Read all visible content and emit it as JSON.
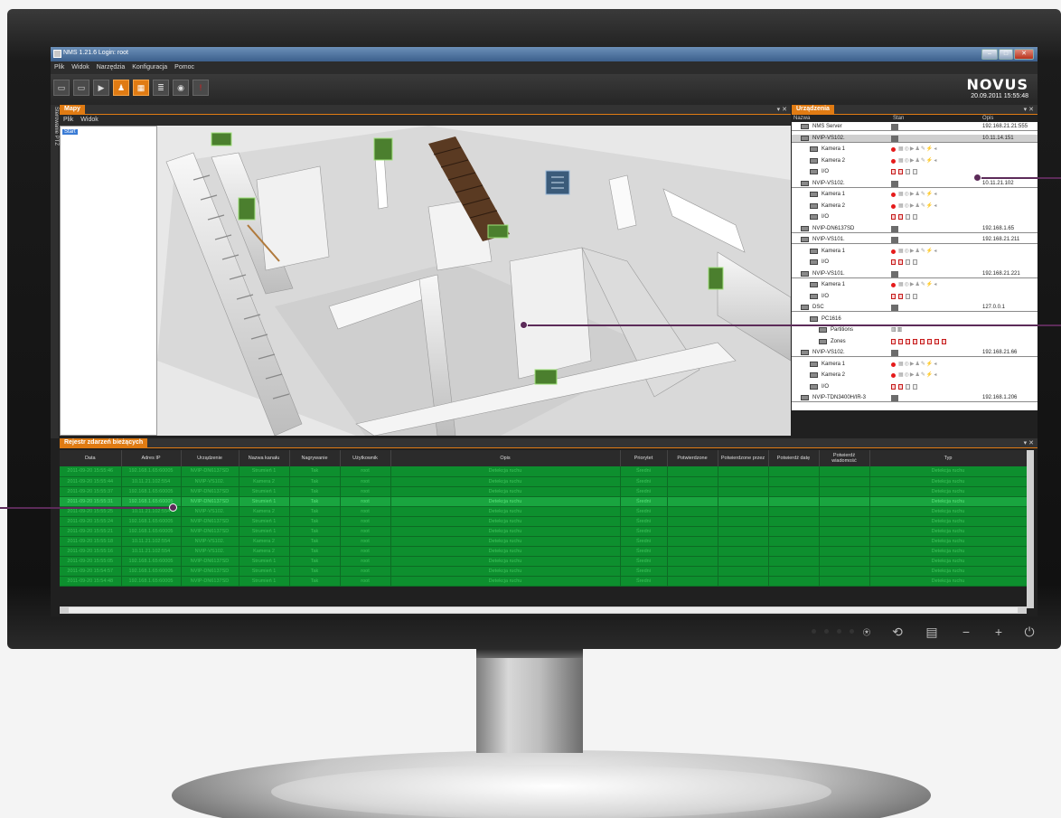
{
  "window": {
    "title": "NMS  1.21.6 Login: root"
  },
  "menu": [
    "Plik",
    "Widok",
    "Narzędzia",
    "Konfiguracja",
    "Pomoc"
  ],
  "header": {
    "logo": "NOVUS",
    "datetime": "20.09.2011 15:55:48"
  },
  "side_tab": "Sterowanie PTZ",
  "maps_panel": {
    "tab": "Mapy",
    "menu": [
      "Plik",
      "Widok"
    ],
    "tree_selected": "Start"
  },
  "devices_panel": {
    "tab": "Urządzenia",
    "columns": [
      "Nazwa",
      "Stan",
      "Opis"
    ],
    "rows": [
      {
        "name": "NMS Server",
        "level": 0,
        "ip": "192.168.21.21:555"
      },
      {
        "name": "NVIP-VS102.",
        "level": 0,
        "ip": "10.11.14.151"
      },
      {
        "name": "Kamera 1",
        "level": 1,
        "ip": ""
      },
      {
        "name": "Kamera 2",
        "level": 1,
        "ip": ""
      },
      {
        "name": "I/O",
        "level": 1,
        "ip": ""
      },
      {
        "name": "NVIP-VS102.",
        "level": 0,
        "ip": "10.11.21.102"
      },
      {
        "name": "Kamera 1",
        "level": 1,
        "ip": ""
      },
      {
        "name": "Kamera 2",
        "level": 1,
        "ip": ""
      },
      {
        "name": "I/O",
        "level": 1,
        "ip": ""
      },
      {
        "name": "NVIP-DN6137SD",
        "level": 0,
        "ip": "192.168.1.65"
      },
      {
        "name": "NVIP-VS101.",
        "level": 0,
        "ip": "192.168.21.211"
      },
      {
        "name": "Kamera 1",
        "level": 1,
        "ip": ""
      },
      {
        "name": "I/O",
        "level": 1,
        "ip": ""
      },
      {
        "name": "NVIP-VS101.",
        "level": 0,
        "ip": "192.168.21.221"
      },
      {
        "name": "Kamera 1",
        "level": 1,
        "ip": ""
      },
      {
        "name": "I/O",
        "level": 1,
        "ip": ""
      },
      {
        "name": "DSC",
        "level": 0,
        "ip": "127.0.0.1"
      },
      {
        "name": "PC1616",
        "level": 1,
        "ip": ""
      },
      {
        "name": "Partitions",
        "level": 2,
        "ip": ""
      },
      {
        "name": "Zones",
        "level": 2,
        "ip": ""
      },
      {
        "name": "NVIP-VS102.",
        "level": 0,
        "ip": "192.168.21.66"
      },
      {
        "name": "Kamera 1",
        "level": 1,
        "ip": ""
      },
      {
        "name": "Kamera 2",
        "level": 1,
        "ip": ""
      },
      {
        "name": "I/O",
        "level": 1,
        "ip": ""
      },
      {
        "name": "NVIP-TDN3400H/IR-3",
        "level": 0,
        "ip": "192.168.1.206"
      }
    ]
  },
  "event_log": {
    "tab": "Rejestr zdarzeń bieżących",
    "columns": [
      "Data",
      "Adres IP",
      "Urządzenie",
      "Nazwa kanału",
      "Nagrywanie",
      "Użytkownik",
      "Opis",
      "Priorytet",
      "Potwierdzone",
      "Potwierdzone przez",
      "Potwierdź datę",
      "Potwierdź wiadomość",
      "Typ"
    ],
    "rows": [
      [
        "2011-09-20 15:55:46",
        "192.168.1.65:60005",
        "NVIP-DN6137SD",
        "Strumień 1",
        "Tak",
        "root",
        "Detekcja ruchu",
        "Średni",
        "",
        "",
        "",
        "",
        "Detekcja ruchu"
      ],
      [
        "2011-09-20 15:55:44",
        "10.11.21.102:554",
        "NVIP-VS102.",
        "Kamera 2",
        "Tak",
        "root",
        "Detekcja ruchu",
        "Średni",
        "",
        "",
        "",
        "",
        "Detekcja ruchu"
      ],
      [
        "2011-09-20 15:55:37",
        "192.168.1.65:60005",
        "NVIP-DN6137SD",
        "Strumień 1",
        "Tak",
        "root",
        "Detekcja ruchu",
        "Średni",
        "",
        "",
        "",
        "",
        "Detekcja ruchu"
      ],
      [
        "2011-09-20 15:55:31",
        "192.168.1.65:60005",
        "NVIP-DN6137SD",
        "Strumień 1",
        "Tak",
        "root",
        "Detekcja ruchu",
        "Średni",
        "",
        "",
        "",
        "",
        "Detekcja ruchu"
      ],
      [
        "2011-09-20 15:55:25",
        "10.11.21.102:554",
        "NVIP-VS102.",
        "Kamera 2",
        "Tak",
        "root",
        "Detekcja ruchu",
        "Średni",
        "",
        "",
        "",
        "",
        "Detekcja ruchu"
      ],
      [
        "2011-09-20 15:55:24",
        "192.168.1.65:60005",
        "NVIP-DN6137SD",
        "Strumień 1",
        "Tak",
        "root",
        "Detekcja ruchu",
        "Średni",
        "",
        "",
        "",
        "",
        "Detekcja ruchu"
      ],
      [
        "2011-09-20 15:55:21",
        "192.168.1.65:60005",
        "NVIP-DN6137SD",
        "Strumień 1",
        "Tak",
        "root",
        "Detekcja ruchu",
        "Średni",
        "",
        "",
        "",
        "",
        "Detekcja ruchu"
      ],
      [
        "2011-09-20 15:55:18",
        "10.11.21.102:554",
        "NVIP-VS102.",
        "Kamera 2",
        "Tak",
        "root",
        "Detekcja ruchu",
        "Średni",
        "",
        "",
        "",
        "",
        "Detekcja ruchu"
      ],
      [
        "2011-09-20 15:55:16",
        "10.11.21.102:554",
        "NVIP-VS102.",
        "Kamera 2",
        "Tak",
        "root",
        "Detekcja ruchu",
        "Średni",
        "",
        "",
        "",
        "",
        "Detekcja ruchu"
      ],
      [
        "2011-09-20 15:55:05",
        "192.168.1.65:60005",
        "NVIP-DN6137SD",
        "Strumień 1",
        "Tak",
        "root",
        "Detekcja ruchu",
        "Średni",
        "",
        "",
        "",
        "",
        "Detekcja ruchu"
      ],
      [
        "2011-09-20 15:54:57",
        "192.168.1.65:60005",
        "NVIP-DN6137SD",
        "Strumień 1",
        "Tak",
        "root",
        "Detekcja ruchu",
        "Średni",
        "",
        "",
        "",
        "",
        "Detekcja ruchu"
      ],
      [
        "2011-09-20 15:54:48",
        "192.168.1.65:60005",
        "NVIP-DN6137SD",
        "Strumień 1",
        "Tak",
        "root",
        "Detekcja ruchu",
        "Średni",
        "",
        "",
        "",
        "",
        "Detekcja ruchu"
      ]
    ]
  },
  "colors": {
    "accent": "#e07b13",
    "log_row": "#0d8f2e",
    "callout": "#5c2b59",
    "alarm": "#e51b1b"
  },
  "icons": [
    "monitor-icon",
    "monitor-icon",
    "play-icon",
    "person-icon",
    "grid-icon",
    "list-icon",
    "camera-icon",
    "alert-icon",
    "power-icon",
    "plus-icon",
    "minus-icon"
  ]
}
